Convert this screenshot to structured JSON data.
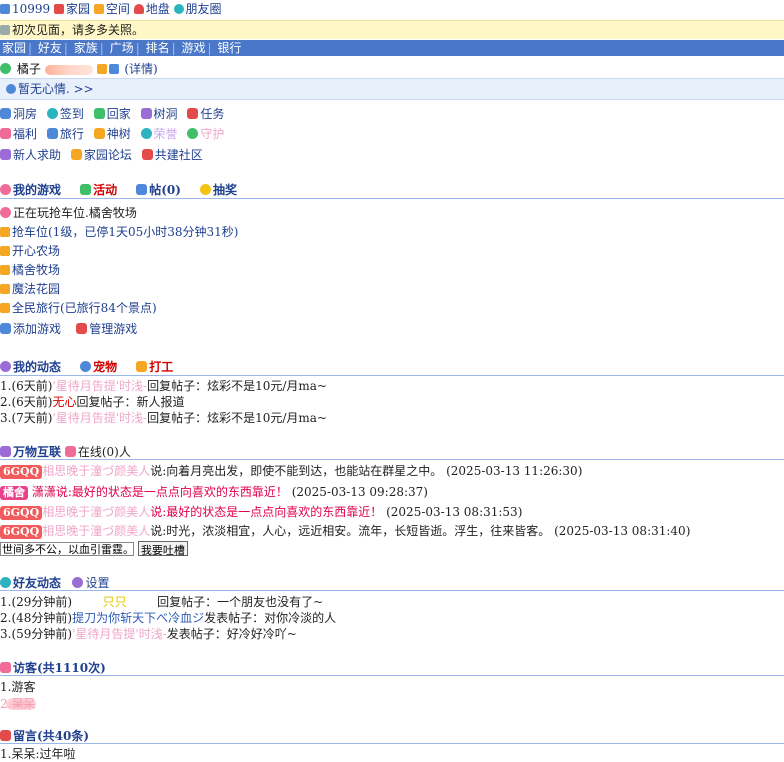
{
  "top": {
    "user_id": "10999",
    "links": [
      "家园",
      "空间",
      "地盘",
      "朋友圈"
    ]
  },
  "notice": "初次见面，请多多关照。",
  "nav": [
    "家园",
    "好友",
    "家族",
    "广场",
    "排名",
    "游戏",
    "银行"
  ],
  "profile": {
    "name": "橘子",
    "detail": "(详情)"
  },
  "mood": "暂无心情. >>",
  "quick_links": {
    "row1": [
      "洞房",
      "签到",
      "回家",
      "树洞",
      "任务"
    ],
    "row2": [
      "福利",
      "旅行",
      "神树",
      "荣誉",
      "守护"
    ],
    "row3": [
      "新人求助",
      "家园论坛",
      "共建社区"
    ]
  },
  "games": {
    "title": "我的游戏",
    "activity": "活动",
    "posts": "帖(0)",
    "lottery": "抽奖",
    "playing": "正在玩抢车位.橘舍牧场",
    "list": [
      "抢车位(1级，已停1天05小时38分钟31秒)",
      "开心农场",
      "橘舍牧场",
      "魔法花园",
      "全民旅行(已旅行84个景点)"
    ],
    "add": "添加游戏",
    "manage": "管理游戏"
  },
  "dynamics": {
    "title": "我的动态",
    "pet": "宠物",
    "work": "打工",
    "items": [
      {
        "idx": "1.",
        "time": "(6天前)",
        "who": "'星待月告提'时浅-",
        "action": "回复帖子：炫彩不是10元/月ma~"
      },
      {
        "idx": "2.",
        "time": "(6天前)",
        "who": "无心",
        "action": "回复帖子：新人报道"
      },
      {
        "idx": "3.",
        "time": "(7天前)",
        "who": "'星待月告提'时浅-",
        "action": "回复帖子：炫彩不是10元/月ma~"
      }
    ]
  },
  "iot": {
    "title": "万物互联",
    "online": "在线(0)人",
    "messages": [
      {
        "tag": "6GQQ",
        "who": "相思晚于潼づ颜美人",
        "text": "说:向着月亮出发，即使不能到达，也能站在群星之中。",
        "time": "(2025-03-13 11:26:30)"
      },
      {
        "tag": "橘舍",
        "who": "潇潇",
        "text": "说:最好的状态是一点点向喜欢的东西靠近！",
        "time": "(2025-03-13 09:28:37)"
      },
      {
        "tag": "6GQQ",
        "who": "相思晚于潼づ颜美人",
        "text": "说:最好的状态是一点点向喜欢的东西靠近！",
        "time": "(2025-03-13 08:31:53)"
      },
      {
        "tag": "6GQQ",
        "who": "相思晚于潼づ颜美人",
        "text": "说:时光，浓淡相宜，人心，远近相安。流年，长短皆逝。浮生，往来皆客。",
        "time": "(2025-03-13 08:31:40)"
      }
    ],
    "input_value": "世间多不公，以血引雷霆。",
    "send": "我要吐槽"
  },
  "friends": {
    "title": "好友动态",
    "settings": "设置",
    "items": [
      {
        "idx": "1.",
        "time": "(29分钟前)",
        "who": "只只",
        "action": "回复帖子：一个朋友也没有了~"
      },
      {
        "idx": "2.",
        "time": "(48分钟前)",
        "who": "提刀为你斩天下べ冷血ジ",
        "action": "发表帖子：对你冷淡的人"
      },
      {
        "idx": "3.",
        "time": "(59分钟前)",
        "who": "'星待月告提'时浅-",
        "action": "发表帖子：好冷好冷吖~"
      }
    ]
  },
  "visitors": {
    "title": "访客(共1110次)",
    "items": [
      "1.游客",
      "2.呆呆"
    ]
  },
  "messages": {
    "title": "留言(共40条)",
    "first": "1.呆呆:过年啦"
  }
}
